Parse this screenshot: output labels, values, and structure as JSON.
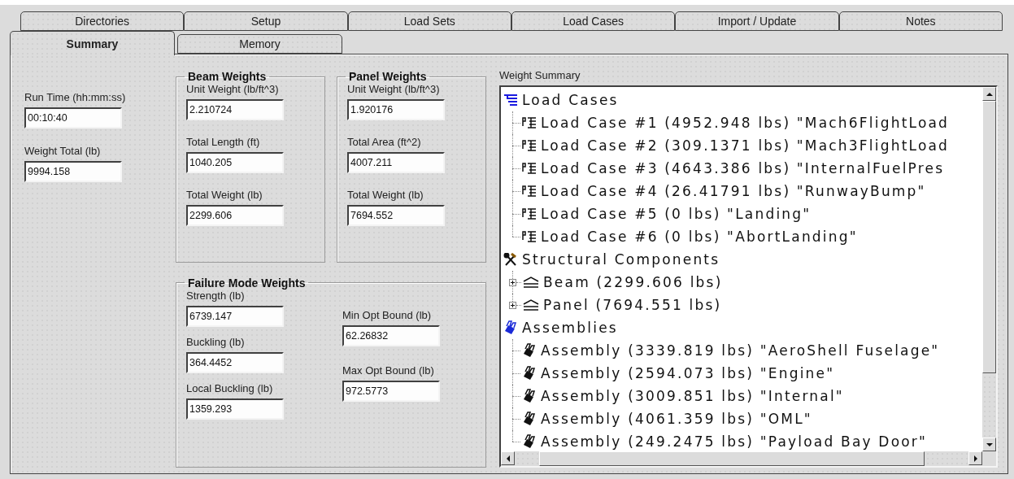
{
  "tab_rows": [
    {
      "tabs": [
        {
          "label": "Directories",
          "selected": false
        },
        {
          "label": "Setup",
          "selected": false
        },
        {
          "label": "Load Sets",
          "selected": false
        },
        {
          "label": "Load Cases",
          "selected": false
        },
        {
          "label": "Import / Update",
          "selected": false
        },
        {
          "label": "Notes",
          "selected": false
        }
      ]
    },
    {
      "tabs": [
        {
          "label": "Summary",
          "selected": true
        },
        {
          "label": "Memory",
          "selected": false
        }
      ]
    }
  ],
  "general": {
    "fields": [
      {
        "label": "Run Time (hh:mm:ss)",
        "value": "00:10:40"
      },
      {
        "label": "Weight Total (lb)",
        "value": "9994.158"
      }
    ]
  },
  "beam_weights": {
    "title": "Beam Weights",
    "fields": [
      {
        "label": "Unit Weight (lb/ft^3)",
        "value": "2.210724"
      },
      {
        "label": "Total Length (ft)",
        "value": "1040.205"
      },
      {
        "label": "Total Weight (lb)",
        "value": "2299.606"
      }
    ]
  },
  "panel_weights": {
    "title": "Panel Weights",
    "fields": [
      {
        "label": "Unit Weight (lb/ft^3)",
        "value": "1.920176"
      },
      {
        "label": "Total Area (ft^2)",
        "value": "4007.211"
      },
      {
        "label": "Total Weight (lb)",
        "value": "7694.552"
      }
    ]
  },
  "failure_mode_weights": {
    "title": "Failure Mode Weights",
    "left_fields": [
      {
        "label": "Strength (lb)",
        "value": "6739.147"
      },
      {
        "label": "Buckling (lb)",
        "value": "364.4452"
      },
      {
        "label": "Local Buckling (lb)",
        "value": "1359.293"
      }
    ],
    "right_fields": [
      {
        "label": "Min Opt Bound (lb)",
        "value": "62.26832"
      },
      {
        "label": "Max Opt Bound (lb)",
        "value": "972.5773"
      }
    ]
  },
  "weight_summary": {
    "label": "Weight Summary",
    "tree": [
      {
        "label": "Load Cases",
        "kind": "load-cases",
        "children": [
          {
            "label": "Load Case #1 (4952.948 lbs) \"Mach6FlightLoad",
            "kind": "load-case"
          },
          {
            "label": "Load Case #2 (309.1371 lbs) \"Mach3FlightLoad",
            "kind": "load-case"
          },
          {
            "label": "Load Case #3 (4643.386 lbs) \"InternalFuelPres",
            "kind": "load-case"
          },
          {
            "label": "Load Case #4 (26.41791 lbs) \"RunwayBump\"",
            "kind": "load-case"
          },
          {
            "label": "Load Case #5 (0 lbs) \"Landing\"",
            "kind": "load-case"
          },
          {
            "label": "Load Case #6 (0 lbs) \"AbortLanding\"",
            "kind": "load-case"
          }
        ]
      },
      {
        "label": "Structural Components",
        "kind": "components",
        "children": [
          {
            "label": "Beam (2299.606 lbs)",
            "kind": "beam",
            "expanded": false
          },
          {
            "label": "Panel (7694.551 lbs)",
            "kind": "beam",
            "expanded": false
          }
        ]
      },
      {
        "label": "Assemblies",
        "kind": "assemblies",
        "children": [
          {
            "label": "Assembly (3339.819 lbs) \"AeroShell Fuselage\"",
            "kind": "assembly"
          },
          {
            "label": "Assembly (2594.073 lbs) \"Engine\"",
            "kind": "assembly"
          },
          {
            "label": "Assembly (3009.851 lbs) \"Internal\"",
            "kind": "assembly"
          },
          {
            "label": "Assembly (4061.359 lbs) \"OML\"",
            "kind": "assembly"
          },
          {
            "label": "Assembly (249.2475 lbs) \"Payload Bay Door\"",
            "kind": "assembly"
          }
        ]
      }
    ]
  }
}
